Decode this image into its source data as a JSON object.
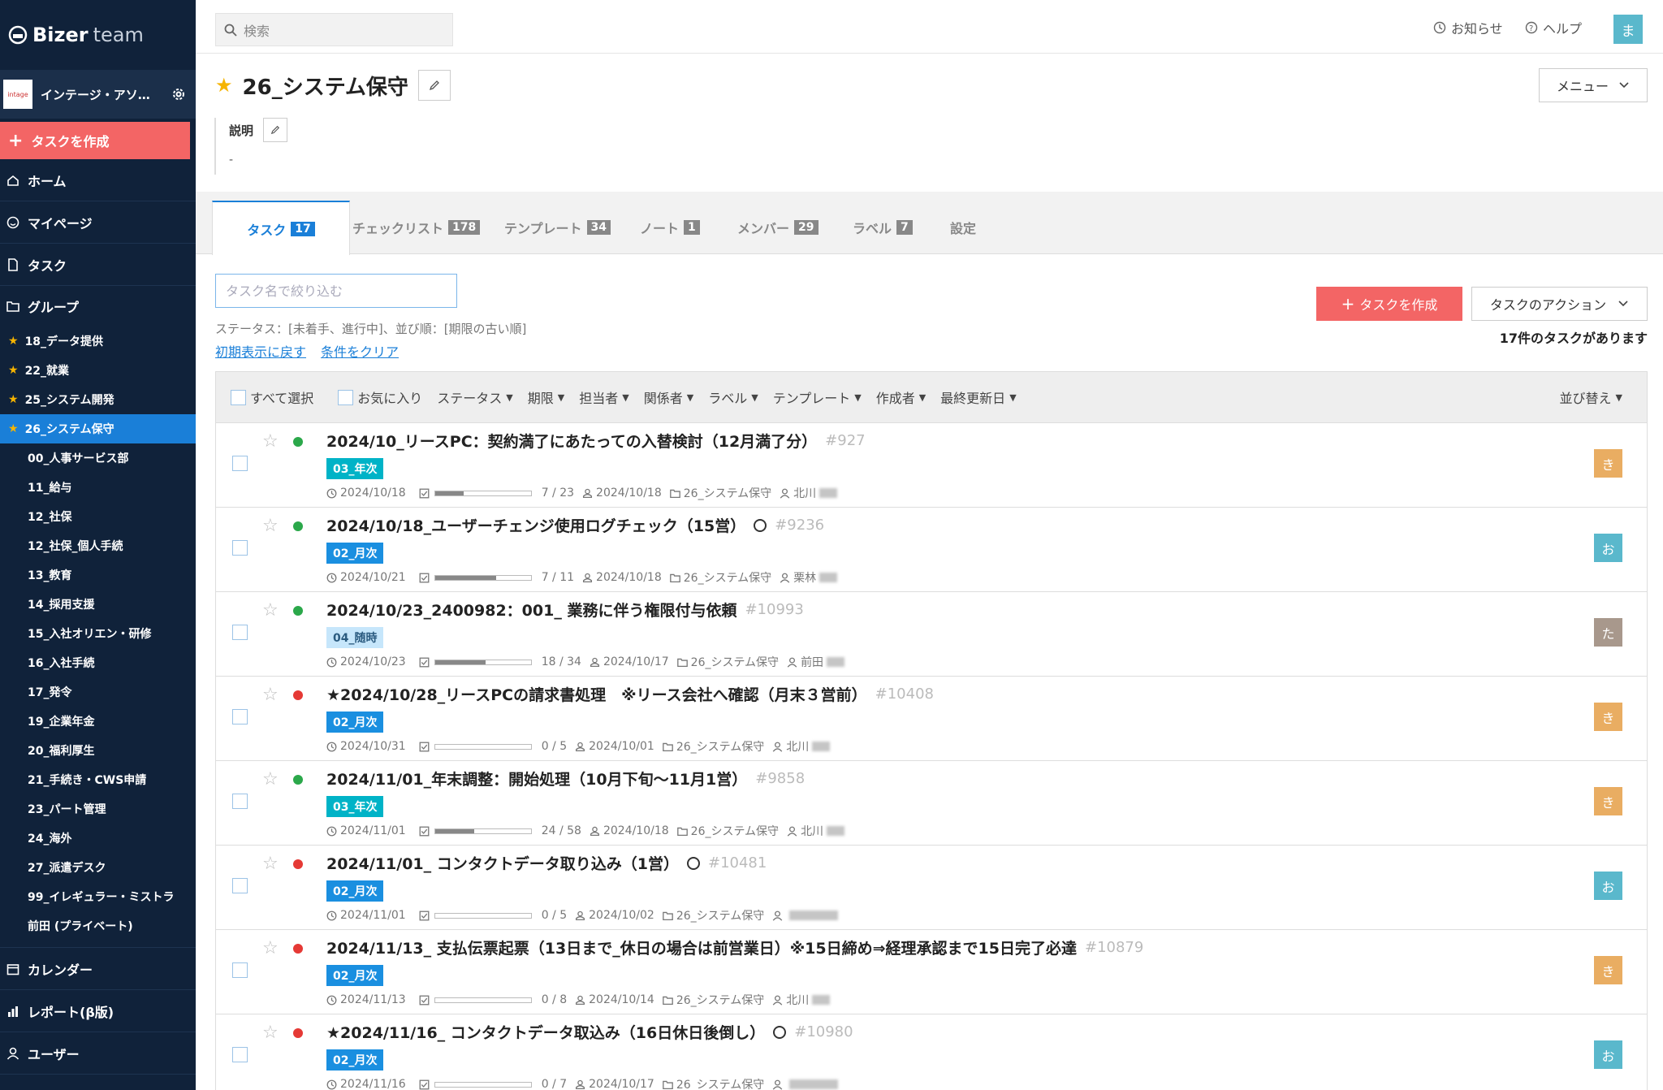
{
  "brand": {
    "bold": "Bizer",
    "light": "team"
  },
  "team_name": "インテージ・アソ…",
  "team_logo_text": "intage",
  "sidebar": {
    "create_label": "タスクを作成",
    "nav_top": [
      {
        "label": "ホーム",
        "icon": "home-icon"
      },
      {
        "label": "マイページ",
        "icon": "smile-icon"
      },
      {
        "label": "タスク",
        "icon": "file-icon"
      }
    ],
    "group_label": "グループ",
    "groups": [
      {
        "label": "18_データ提供",
        "starred": true,
        "active": false
      },
      {
        "label": "22_就業",
        "starred": true,
        "active": false
      },
      {
        "label": "25_システム開発",
        "starred": true,
        "active": false
      },
      {
        "label": "26_システム保守",
        "starred": true,
        "active": true
      },
      {
        "label": "00_人事サービス部",
        "starred": false,
        "active": false
      },
      {
        "label": "11_給与",
        "starred": false,
        "active": false
      },
      {
        "label": "12_社保",
        "starred": false,
        "active": false
      },
      {
        "label": "12_社保_個人手続",
        "starred": false,
        "active": false
      },
      {
        "label": "13_教育",
        "starred": false,
        "active": false
      },
      {
        "label": "14_採用支援",
        "starred": false,
        "active": false
      },
      {
        "label": "15_入社オリエン・研修",
        "starred": false,
        "active": false
      },
      {
        "label": "16_入社手続",
        "starred": false,
        "active": false
      },
      {
        "label": "17_発令",
        "starred": false,
        "active": false
      },
      {
        "label": "19_企業年金",
        "starred": false,
        "active": false
      },
      {
        "label": "20_福利厚生",
        "starred": false,
        "active": false
      },
      {
        "label": "21_手続き・CWS申請",
        "starred": false,
        "active": false
      },
      {
        "label": "23_パート管理",
        "starred": false,
        "active": false
      },
      {
        "label": "24_海外",
        "starred": false,
        "active": false
      },
      {
        "label": "27_派遣デスク",
        "starred": false,
        "active": false
      },
      {
        "label": "99_イレギュラー・ミストラ",
        "starred": false,
        "active": false
      },
      {
        "label": "前田 (プライベート)",
        "starred": false,
        "active": false
      }
    ],
    "nav_bottom": [
      {
        "label": "カレンダー",
        "icon": "calendar-icon"
      },
      {
        "label": "レポート(β版)",
        "icon": "bar-chart-icon"
      },
      {
        "label": "ユーザー",
        "icon": "user-icon"
      }
    ]
  },
  "topbar": {
    "search_placeholder": "検索",
    "notice": "お知らせ",
    "help": "ヘルプ",
    "avatar": "ま"
  },
  "page": {
    "title": "26_システム保守",
    "menu": "メニュー",
    "desc_label": "説明",
    "desc_value": "-"
  },
  "tabs": [
    {
      "label": "タスク",
      "count": "17",
      "active": true
    },
    {
      "label": "チェックリスト",
      "count": "178",
      "active": false
    },
    {
      "label": "テンプレート",
      "count": "34",
      "active": false
    },
    {
      "label": "ノート",
      "count": "1",
      "active": false
    },
    {
      "label": "メンバー",
      "count": "29",
      "active": false
    },
    {
      "label": "ラベル",
      "count": "7",
      "active": false
    },
    {
      "label": "設定",
      "count": "",
      "active": false
    }
  ],
  "filter": {
    "placeholder": "タスク名で絞り込む",
    "conditions": "ステータス：[未着手、進行中]、並び順：[期限の古い順]",
    "reset": "初期表示に戻す",
    "clear": "条件をクリア",
    "create": "タスクを作成",
    "actions": "タスクのアクション",
    "count": "17件のタスクがあります"
  },
  "table_header": {
    "select_all": "すべて選択",
    "favorite": "お気に入り",
    "cols": [
      "ステータス",
      "期限",
      "担当者",
      "関係者",
      "ラベル",
      "テンプレート",
      "作成者",
      "最終更新日"
    ],
    "sort": "並び替え"
  },
  "colors": {
    "green": "#2ba84a",
    "red": "#e53935",
    "label_cyan": "#00b3c7",
    "label_blue": "#1a8fe0",
    "label_light": "#c6e6fb",
    "av_orange": "#e9ad62",
    "av_cyan": "#5ab8cc",
    "av_brown": "#a8988c"
  },
  "tasks": [
    {
      "status": "green",
      "title": "2024/10_リースPC：契約満了にあたっての入替検討（12月満了分）",
      "ring": false,
      "id": "#927",
      "label": "03_年次",
      "label_color": "cyan",
      "due": "2024/10/18",
      "progress": 0.3,
      "progress_text": "7 / 23",
      "created": "2024/10/18",
      "group": "26_システム保守",
      "assignee": "北川",
      "avatar": "き",
      "avatar_color": "orange"
    },
    {
      "status": "green",
      "title": "2024/10/18_ユーザーチェンジ使用ログチェック（15営）",
      "ring": true,
      "id": "#9236",
      "label": "02_月次",
      "label_color": "blue",
      "due": "2024/10/21",
      "progress": 0.64,
      "progress_text": "7 / 11",
      "created": "2024/10/18",
      "group": "26_システム保守",
      "assignee": "栗林",
      "avatar": "お",
      "avatar_color": "cyan"
    },
    {
      "status": "green",
      "title": "2024/10/23_2400982：001_ 業務に伴う権限付与依頼",
      "ring": false,
      "id": "#10993",
      "label": "04_随時",
      "label_color": "light",
      "due": "2024/10/23",
      "progress": 0.53,
      "progress_text": "18 / 34",
      "created": "2024/10/17",
      "group": "26_システム保守",
      "assignee": "前田",
      "avatar": "た",
      "avatar_color": "brown"
    },
    {
      "status": "red",
      "title": "★2024/10/28_リースPCの請求書処理　※リース会社へ確認（月末３営前）",
      "ring": false,
      "id": "#10408",
      "label": "02_月次",
      "label_color": "blue",
      "due": "2024/10/31",
      "progress": 0.0,
      "progress_text": "0 / 5",
      "created": "2024/10/01",
      "group": "26_システム保守",
      "assignee": "北川",
      "avatar": "き",
      "avatar_color": "orange"
    },
    {
      "status": "green",
      "title": "2024/11/01_年末調整：開始処理（10月下旬〜11月1営）",
      "ring": false,
      "id": "#9858",
      "label": "03_年次",
      "label_color": "cyan",
      "due": "2024/11/01",
      "progress": 0.41,
      "progress_text": "24 / 58",
      "created": "2024/10/18",
      "group": "26_システム保守",
      "assignee": "北川",
      "avatar": "き",
      "avatar_color": "orange"
    },
    {
      "status": "red",
      "title": "2024/11/01_ コンタクトデータ取り込み（1営）",
      "ring": true,
      "id": "#10481",
      "label": "02_月次",
      "label_color": "blue",
      "due": "2024/11/01",
      "progress": 0.0,
      "progress_text": "0 / 5",
      "created": "2024/10/02",
      "group": "26_システム保守",
      "assignee": "",
      "avatar": "お",
      "avatar_color": "cyan"
    },
    {
      "status": "red",
      "title": "2024/11/13_ 支払伝票起票（13日まで_休日の場合は前営業日）※15日締め⇒経理承認まで15日完了必達",
      "ring": false,
      "id": "#10879",
      "label": "02_月次",
      "label_color": "blue",
      "due": "2024/11/13",
      "progress": 0.0,
      "progress_text": "0 / 8",
      "created": "2024/10/14",
      "group": "26_システム保守",
      "assignee": "北川",
      "avatar": "き",
      "avatar_color": "orange"
    },
    {
      "status": "red",
      "title": "★2024/11/16_ コンタクトデータ取込み（16日休日後倒し）",
      "ring": true,
      "id": "#10980",
      "label": "02_月次",
      "label_color": "blue",
      "due": "2024/11/16",
      "progress": 0.0,
      "progress_text": "0 / 7",
      "created": "2024/10/17",
      "group": "26_システム保守",
      "assignee": "",
      "avatar": "お",
      "avatar_color": "cyan"
    }
  ]
}
